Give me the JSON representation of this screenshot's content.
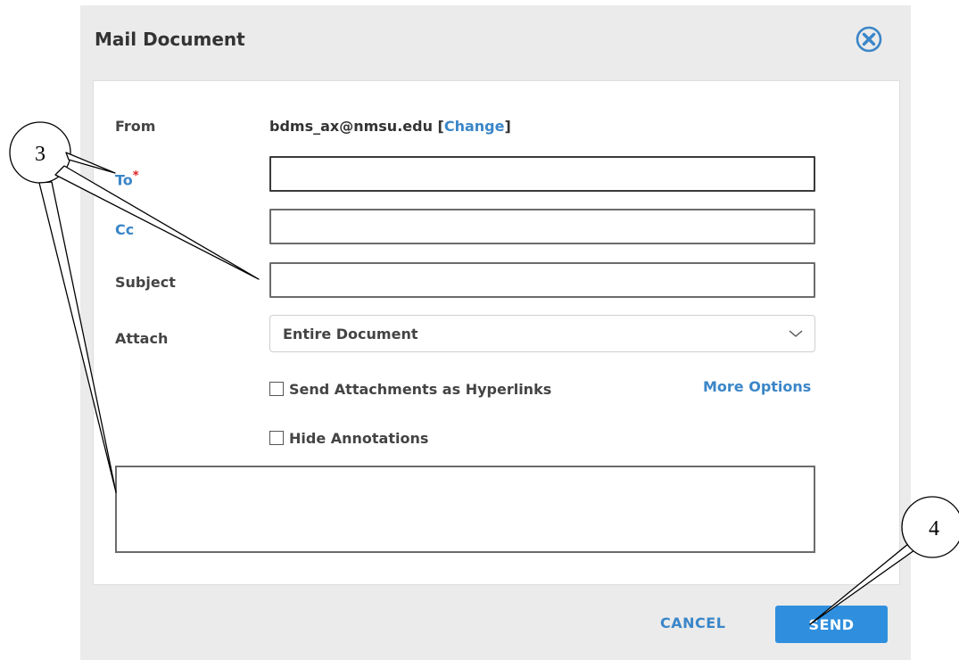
{
  "dialog": {
    "title": "Mail Document",
    "close_icon": "close-circle-icon"
  },
  "form": {
    "from_label": "From",
    "from_email": "bdms_ax@nmsu.edu",
    "bracket_open": "[",
    "change_link": "Change",
    "bracket_close": "]",
    "to_label": "To",
    "required_marker": "*",
    "to_value": "",
    "cc_label": "Cc",
    "cc_value": "",
    "subject_label": "Subject",
    "subject_value": "",
    "attach_label": "Attach",
    "attach_selected": "Entire Document",
    "send_as_hyperlinks_label": "Send Attachments as Hyperlinks",
    "send_as_hyperlinks_checked": false,
    "more_options_label": "More Options",
    "hide_annotations_label": "Hide Annotations",
    "hide_annotations_checked": false,
    "message_value": ""
  },
  "footer": {
    "cancel_label": "CANCEL",
    "send_label": "SEND"
  },
  "callouts": {
    "fields_number": "3",
    "send_number": "4"
  },
  "colors": {
    "accent": "#3b86c8",
    "send_button": "#2f8fde",
    "required": "#e01f1f",
    "dialog_background": "#ebebeb"
  }
}
